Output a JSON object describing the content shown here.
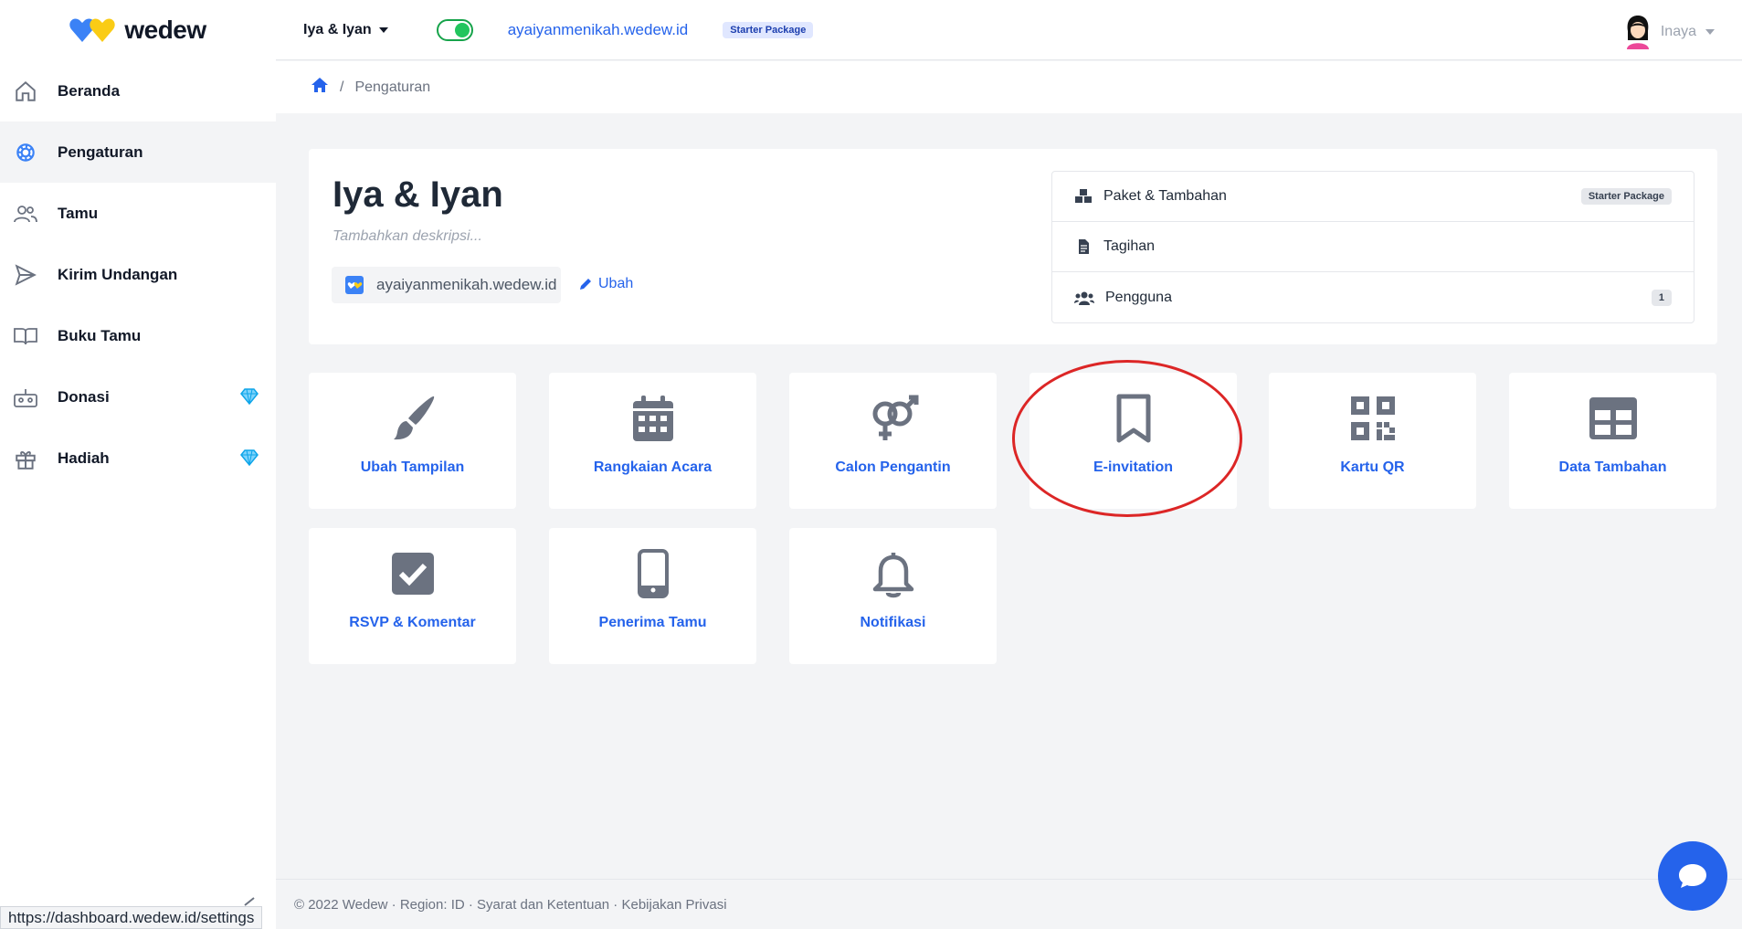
{
  "brand": {
    "name": "wedew"
  },
  "sidebar": {
    "items": [
      {
        "label": "Beranda",
        "icon": "home-icon"
      },
      {
        "label": "Pengaturan",
        "icon": "gear-icon",
        "active": true
      },
      {
        "label": "Tamu",
        "icon": "users-icon"
      },
      {
        "label": "Kirim Undangan",
        "icon": "send-icon"
      },
      {
        "label": "Buku Tamu",
        "icon": "book-icon"
      },
      {
        "label": "Donasi",
        "icon": "donation-icon",
        "premium": true
      },
      {
        "label": "Hadiah",
        "icon": "gift-icon",
        "premium": true
      }
    ]
  },
  "header": {
    "project": "Iya & Iyan",
    "domain": "ayaiyanmenikah.wedew.id",
    "package": "Starter Package",
    "user": "Inaya"
  },
  "breadcrumb": {
    "current": "Pengaturan"
  },
  "event": {
    "title": "Iya & Iyan",
    "description_placeholder": "Tambahkan deskripsi...",
    "domain": "ayaiyanmenikah.wedew.id",
    "edit_label": "Ubah"
  },
  "account_menu": [
    {
      "label": "Paket & Tambahan",
      "icon": "cubes-icon",
      "badge": "Starter Package"
    },
    {
      "label": "Tagihan",
      "icon": "invoice-icon",
      "badge": ""
    },
    {
      "label": "Pengguna",
      "icon": "users-group-icon",
      "badge": "1"
    }
  ],
  "tiles": [
    {
      "label": "Ubah Tampilan",
      "icon": "paint-brush-icon"
    },
    {
      "label": "Rangkaian Acara",
      "icon": "calendar-icon"
    },
    {
      "label": "Calon Pengantin",
      "icon": "gender-icon"
    },
    {
      "label": "E-invitation",
      "icon": "bookmark-icon"
    },
    {
      "label": "Kartu QR",
      "icon": "qr-code-icon"
    },
    {
      "label": "Data Tambahan",
      "icon": "table-icon"
    },
    {
      "label": "RSVP & Komentar",
      "icon": "check-square-icon"
    },
    {
      "label": "Penerima Tamu",
      "icon": "mobile-icon"
    },
    {
      "label": "Notifikasi",
      "icon": "bell-icon"
    }
  ],
  "footer": {
    "text": "© 2022 Wedew · Region: ID · Syarat dan Ketentuan · Kebijakan Privasi"
  },
  "status_url": "https://dashboard.wedew.id/settings",
  "colors": {
    "accent": "#2563eb",
    "toggle": "#22c55e",
    "highlight": "#dc2626",
    "icon_gray": "#6b7280"
  }
}
